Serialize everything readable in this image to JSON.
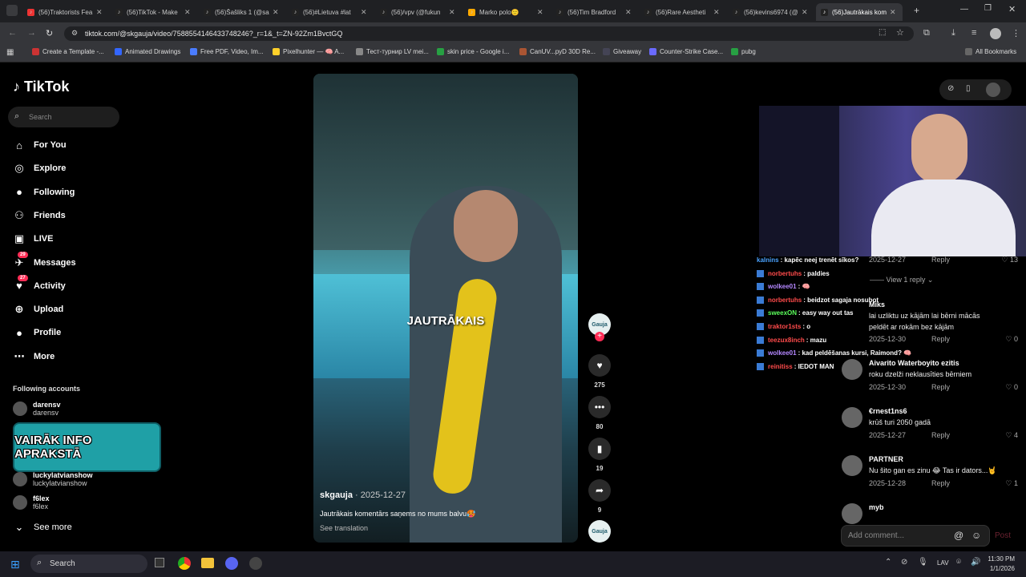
{
  "browser": {
    "tabs": [
      {
        "title": "(56)Traktorists Fea"
      },
      {
        "title": "(56)TikTok - Make"
      },
      {
        "title": "(56)Šašliks 1 (@sa"
      },
      {
        "title": "(56)#Lietuva #lat"
      },
      {
        "title": "(56)/vpv (@fukun"
      },
      {
        "title": "Marko polo🙂"
      },
      {
        "title": "(56)Tim Bradford"
      },
      {
        "title": "(56)Rare Aestheti"
      },
      {
        "title": "(56)kevins6974 (@"
      },
      {
        "title": "(56)Jautrākais kom"
      }
    ],
    "url": "tiktok.com/@skgauja/video/7588554146433748246?_r=1&_t=ZN-92Zm1BvctGQ",
    "bookmarks": [
      "Create a Template -...",
      "Animated Drawings",
      "Free PDF, Video, Im...",
      "Pixelhunter — 🧠 A...",
      "Тест-турнир LV mei...",
      "skin price - Google i...",
      "CanUV...pyD 30D Re...",
      "Giveaway",
      "Counter-Strike Case...",
      "pubg"
    ],
    "all_bookmarks": "All Bookmarks"
  },
  "sidebar": {
    "logo": "TikTok",
    "search_placeholder": "Search",
    "nav": [
      {
        "label": "For You",
        "icon": "home-icon"
      },
      {
        "label": "Explore",
        "icon": "compass-icon"
      },
      {
        "label": "Following",
        "icon": "following-icon"
      },
      {
        "label": "Friends",
        "icon": "friends-icon"
      },
      {
        "label": "LIVE",
        "icon": "live-icon"
      },
      {
        "label": "Messages",
        "icon": "messages-icon",
        "badge": "29"
      },
      {
        "label": "Activity",
        "icon": "activity-icon",
        "badge": "27"
      },
      {
        "label": "Upload",
        "icon": "upload-icon"
      },
      {
        "label": "Profile",
        "icon": "profile-icon"
      },
      {
        "label": "More",
        "icon": "more-icon"
      }
    ],
    "following_header": "Following accounts",
    "following": [
      {
        "name": "darensv",
        "handle": "darensv"
      },
      {
        "name": "luckylatvianshow",
        "handle": "luckylatvianshow"
      },
      {
        "name": "f6lex",
        "handle": "f6lex"
      }
    ],
    "see_more": "See more"
  },
  "overlay_banner": "VAIRĀK INFO APRAKSTĀ",
  "video": {
    "caption_word": "JAUTRĀKAIS",
    "author": "skgauja",
    "date": "2025-12-27",
    "description": "Jautrākais komentārs saņems no mums balvu🥵",
    "see_translation": "See translation"
  },
  "actions": {
    "likes": "275",
    "comments": "80",
    "saves": "19",
    "shares": "9"
  },
  "stream_chat": [
    {
      "user": "kalnins",
      "text": ": kapēc neej trenēt sīkos?",
      "color": "#4ba3ff"
    },
    {
      "user": "norbertuhs",
      "text": ": paldies",
      "color": "#ff4b4b"
    },
    {
      "user": "wolkee01",
      "text": ": 🧠",
      "color": "#b487ff"
    },
    {
      "user": "norbertuhs",
      "text": ": beidzot sagaja nosubot",
      "color": "#ff4b4b"
    },
    {
      "user": "sweexON",
      "text": ": easy way out tas",
      "color": "#5bff5b"
    },
    {
      "user": "traktor1sts",
      "text": ": o",
      "color": "#ff4b4b"
    },
    {
      "user": "teezux8inch",
      "text": ": mazu",
      "color": "#ff4b4b"
    },
    {
      "user": "wolkee01",
      "text": ": kad peldēšanas kursi, Raimond? 🧠",
      "color": "#b487ff"
    },
    {
      "user": "reinitiss",
      "text": ": IEDOT MAN",
      "color": "#ff4b4b"
    }
  ],
  "comments": {
    "top_meta": {
      "date": "2025-12-27",
      "reply": "Reply",
      "likes": "13"
    },
    "view_replies": "View 1 reply",
    "items": [
      {
        "user": "Miks",
        "text": "lai uzliktu uz kājām lai bērni mācās",
        "text2": "peldēt ar rokām bez kājām",
        "date": "2025-12-30",
        "reply": "Reply",
        "likes": "0"
      },
      {
        "user": "Aivarito Waterboyito ezitis",
        "text": "roku dzelži neklausīties bērniem",
        "date": "2025-12-30",
        "reply": "Reply",
        "likes": "0"
      },
      {
        "user": "€rnest1ns6",
        "text": "krūš turi 2050 gadā",
        "date": "2025-12-27",
        "reply": "Reply",
        "likes": "4"
      },
      {
        "user": "PARTNER",
        "text": "Nu šito gan es zinu 😂 Tas ir dators...🤘",
        "date": "2025-12-28",
        "reply": "Reply",
        "likes": "1"
      },
      {
        "user": "myb",
        "text": ""
      }
    ],
    "add_placeholder": "Add comment...",
    "post": "Post"
  },
  "taskbar": {
    "search": "Search",
    "lang": "LAV",
    "time": "11:30 PM",
    "date": "1/1/2026"
  }
}
